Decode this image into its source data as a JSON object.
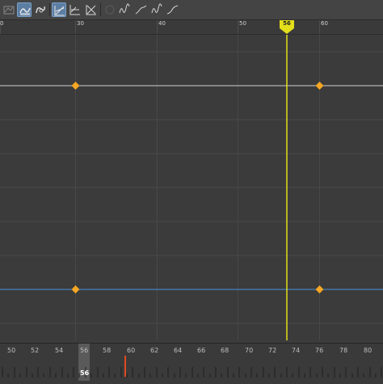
{
  "toolbar": {
    "icons": [
      "curve-editor-icon",
      "tangents-icon",
      "key-tangent-icon",
      "normalize-icon",
      "stacked-icon",
      "buffer-icon",
      "infinity-icon",
      "cycle-icon",
      "cycle-offset-icon",
      "oscillate-icon",
      "linear-icon"
    ]
  },
  "ruler": {
    "labels": [
      "0",
      "30",
      "40",
      "50",
      "60"
    ],
    "playhead_label": "56"
  },
  "timeline": {
    "labels": [
      "50",
      "52",
      "54",
      "56",
      "58",
      "60",
      "62",
      "64",
      "66",
      "68",
      "70",
      "72",
      "74",
      "76",
      "78",
      "80"
    ],
    "current_frame": "56",
    "current_marker_color": "#e04a1f"
  },
  "colors": {
    "playhead": "#e3de1a",
    "key": "#f5a623",
    "curve_white": "#cfcfcf",
    "curve_blue": "#4a90d9"
  }
}
